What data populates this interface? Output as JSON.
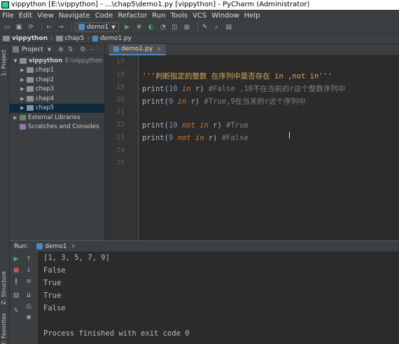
{
  "window": {
    "title": "vippython [E:\\vippython] - ...\\chap5\\demo1.py [vippython] - PyCharm (Administrator)"
  },
  "menu": [
    "File",
    "Edit",
    "View",
    "Navigate",
    "Code",
    "Refactor",
    "Run",
    "Tools",
    "VCS",
    "Window",
    "Help"
  ],
  "toolbar": {
    "run_config": "demo1",
    "icons": [
      "open-icon",
      "save-icon",
      "sync-icon",
      "back-icon",
      "forward-icon",
      "run-icon",
      "debug-icon",
      "coverage-icon",
      "profile-icon",
      "concurrency-icon",
      "stop-icon",
      "wrench-icon",
      "search-icon",
      "vcs-icon"
    ]
  },
  "breadcrumb": [
    "vippython",
    "chap5",
    "demo1.py"
  ],
  "project_panel": {
    "title": "Project",
    "root": {
      "name": "vippython",
      "path": "E:\\vippython"
    },
    "folders": [
      "chap1",
      "chap2",
      "chap3",
      "chap4",
      "chap5"
    ],
    "selected": "chap5",
    "external": "External Libraries",
    "scratches": "Scratches and Consoles"
  },
  "side_tabs": {
    "project": "1: Project",
    "structure": "Z: Structure",
    "favorites": "2: Favorites"
  },
  "editor": {
    "tab": "demo1.py",
    "lines": [
      {
        "n": "17",
        "parts": []
      },
      {
        "n": "18",
        "parts": [
          {
            "t": "str",
            "v": "'''判断指定的整数 在序列中是否存在 in ,not in'''"
          }
        ]
      },
      {
        "n": "19",
        "parts": [
          {
            "t": "plain",
            "v": "print("
          },
          {
            "t": "num",
            "v": "10"
          },
          {
            "t": "plain",
            "v": " "
          },
          {
            "t": "kw",
            "v": "in"
          },
          {
            "t": "plain",
            "v": " r) "
          },
          {
            "t": "cmt",
            "v": "#False ,10不在当前的r这个整数序列中"
          }
        ]
      },
      {
        "n": "20",
        "parts": [
          {
            "t": "plain",
            "v": "print("
          },
          {
            "t": "num",
            "v": "9"
          },
          {
            "t": "plain",
            "v": " "
          },
          {
            "t": "kw",
            "v": "in"
          },
          {
            "t": "plain",
            "v": " r) "
          },
          {
            "t": "cmt",
            "v": "#True,9在当关的r这个序列中"
          }
        ]
      },
      {
        "n": "21",
        "parts": []
      },
      {
        "n": "22",
        "parts": [
          {
            "t": "plain",
            "v": "print("
          },
          {
            "t": "num",
            "v": "10"
          },
          {
            "t": "plain",
            "v": " "
          },
          {
            "t": "kw",
            "v": "not in"
          },
          {
            "t": "plain",
            "v": " r) "
          },
          {
            "t": "cmt",
            "v": "#True"
          }
        ]
      },
      {
        "n": "23",
        "parts": [
          {
            "t": "plain",
            "v": "print("
          },
          {
            "t": "num",
            "v": "9"
          },
          {
            "t": "plain",
            "v": " "
          },
          {
            "t": "kw",
            "v": "not in"
          },
          {
            "t": "plain",
            "v": " r) "
          },
          {
            "t": "cmt",
            "v": "#False"
          }
        ]
      },
      {
        "n": "24",
        "parts": []
      },
      {
        "n": "25",
        "parts": []
      }
    ],
    "current_line": "23"
  },
  "run_panel": {
    "label": "Run:",
    "tab": "demo1",
    "output": [
      "[1, 3, 5, 7, 9]",
      "False",
      "True",
      "True",
      "False",
      "",
      "Process finished with exit code 0"
    ]
  },
  "colors": {
    "background": "#2b2b2b",
    "panel": "#3c3f41",
    "keyword": "#cc7832",
    "number": "#6897bb",
    "comment": "#808080",
    "docstring": "#d4a959",
    "selection": "#0d293e"
  }
}
